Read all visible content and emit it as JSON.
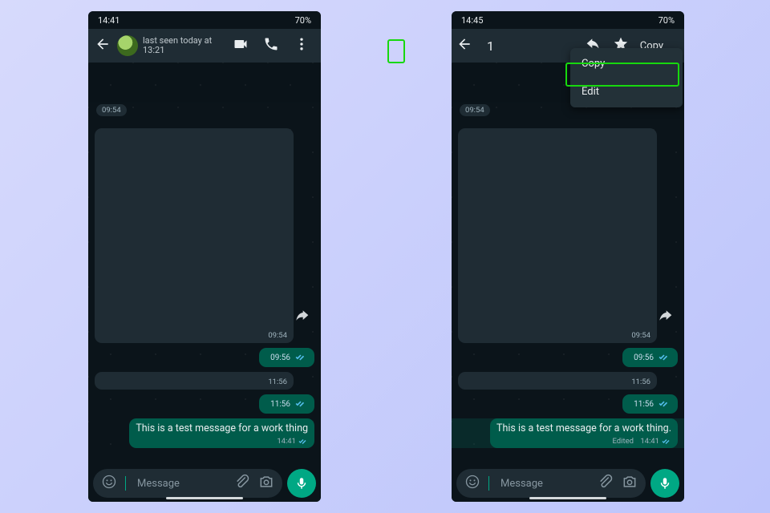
{
  "left": {
    "status": {
      "time": "14:41",
      "battery": "70%"
    },
    "appbar": {
      "sub": "last seen today at 13:21"
    },
    "pill_time": "09:54",
    "big_block_time": "09:54",
    "small_block_time": "11:56",
    "sent1": "09:56",
    "sent2": "11:56",
    "msg": {
      "text": "This is a test message for a work thing",
      "time": "14:41"
    },
    "input": {
      "placeholder": "Message"
    }
  },
  "right": {
    "status": {
      "time": "14:45",
      "battery": "70%"
    },
    "selbar": {
      "count": "1"
    },
    "menu": {
      "copy": "Copy",
      "edit": "Edit"
    },
    "quoted_time": "09:54",
    "pill_time": "09:54",
    "big_block_time": "09:54",
    "small_block_time": "11:56",
    "sent1": "09:56",
    "sent2": "11:56",
    "msg": {
      "text": "This is a test message for a work thing.",
      "time": "14:41",
      "edited": "Edited"
    },
    "input": {
      "placeholder": "Message"
    }
  }
}
